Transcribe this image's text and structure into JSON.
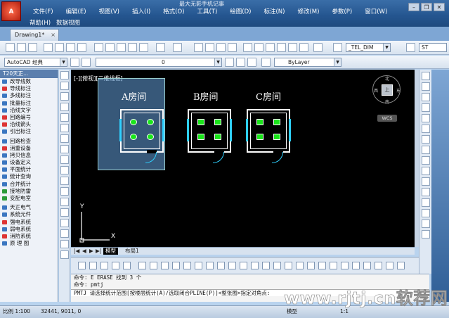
{
  "window": {
    "title": "最大无影手机记事",
    "app_logo": "A"
  },
  "menu": {
    "row1": [
      "文件(F)",
      "编辑(E)",
      "视图(V)",
      "插入(I)",
      "格式(O)",
      "工具(T)",
      "绘图(D)",
      "标注(N)",
      "修改(M)",
      "参数(P)",
      "窗口(W)"
    ],
    "row2": [
      "帮助(H)",
      "数据视图"
    ]
  },
  "tabs": {
    "doc": "Drawing1*"
  },
  "toolbar": {
    "workspace": "AutoCAD 经典",
    "layer_value": "0",
    "bylayer": "ByLayer",
    "dim_style": "_TEL_DIM",
    "text_style": "ST"
  },
  "left_panel": {
    "header": "T20天正...",
    "groups": [
      [
        "改导线数",
        "导线标注",
        "多线标注",
        "批量标注",
        "沿线文字",
        "回路编号",
        "沿线箭头",
        "引出标注"
      ],
      [
        "回路检查",
        "消重设备",
        "拷贝信息",
        "设备定义",
        "平面统计",
        "统计查询",
        "合并统计",
        "接地防雷",
        "变配电室"
      ],
      [
        "天正电气",
        "系统元件",
        "强电系统",
        "弱电系统",
        "消防系统",
        "原 理 图"
      ]
    ]
  },
  "canvas": {
    "view_label": "[-][俯视][二维线框]",
    "rooms": [
      {
        "title": "A房间"
      },
      {
        "title": "B房间"
      },
      {
        "title": "C房间"
      }
    ],
    "ucs_y": "Y",
    "ucs_x": "X",
    "compass": {
      "center": "上",
      "n": "北",
      "s": "南",
      "e": "东",
      "w": "西"
    },
    "wcs": "WCS"
  },
  "layout_tabs": {
    "model": "模型",
    "layout1": "布局1"
  },
  "command": {
    "line1": "命令: E ERASE 找到 3 个",
    "line2": "命令: pmtj",
    "prompt": "PMTJ 请选择统计范围[按楼层统计(A)/选取闭合PLINE(P)]<整张图>指定对角点:"
  },
  "status": {
    "scale": "比例 1:100",
    "coords": "32441, 9011, 0",
    "model": "模型",
    "ratio": "1:1"
  },
  "watermark": "www.rjtj.cn软荐网"
}
